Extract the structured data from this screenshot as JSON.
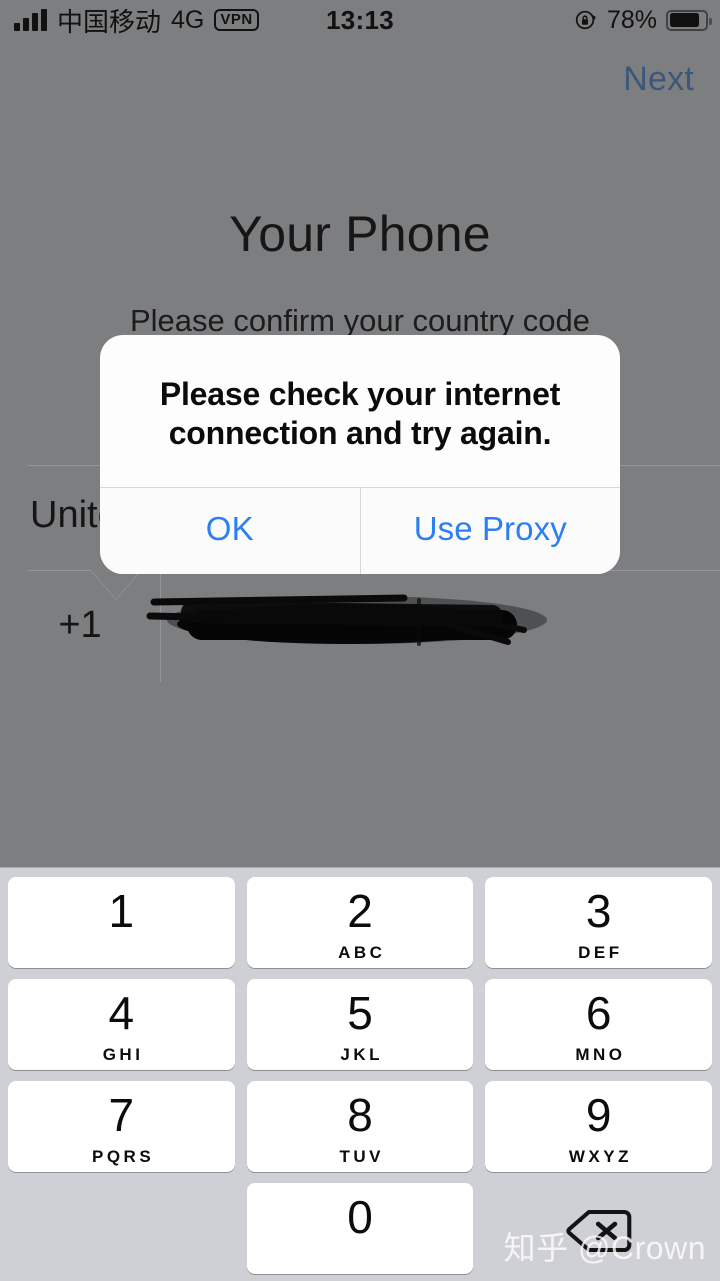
{
  "status_bar": {
    "signal_icon": "signal-bars-icon",
    "carrier": "中国移动",
    "network": "4G",
    "vpn_badge": "VPN",
    "time": "13:13",
    "rotation_lock_icon": "rotation-lock-icon",
    "battery_percent": "78%",
    "battery_level": 78
  },
  "page": {
    "next_label": "Next",
    "title": "Your Phone",
    "subtitle": "Please confirm your country code",
    "country_name": "United States",
    "country_code": "+1",
    "phone_number": "",
    "phone_number_redacted": true
  },
  "alert": {
    "message": "Please check your internet connection and try again.",
    "buttons": [
      {
        "label": "OK",
        "name": "ok-button"
      },
      {
        "label": "Use Proxy",
        "name": "use-proxy-button"
      }
    ]
  },
  "keypad": {
    "keys": [
      {
        "digit": "1",
        "letters": ""
      },
      {
        "digit": "2",
        "letters": "ABC"
      },
      {
        "digit": "3",
        "letters": "DEF"
      },
      {
        "digit": "4",
        "letters": "GHI"
      },
      {
        "digit": "5",
        "letters": "JKL"
      },
      {
        "digit": "6",
        "letters": "MNO"
      },
      {
        "digit": "7",
        "letters": "PQRS"
      },
      {
        "digit": "8",
        "letters": "TUV"
      },
      {
        "digit": "9",
        "letters": "WXYZ"
      },
      {
        "digit": "0",
        "letters": ""
      }
    ],
    "delete_icon": "backspace-icon"
  },
  "watermark": "知乎 @Crown",
  "colors": {
    "dim_overlay": "#7d7e80",
    "alert_blue": "#2c7ff0",
    "next_blue_dimmed": "#3c5779",
    "keypad_bg": "#cfd0d6",
    "key_bg": "#ffffff"
  }
}
